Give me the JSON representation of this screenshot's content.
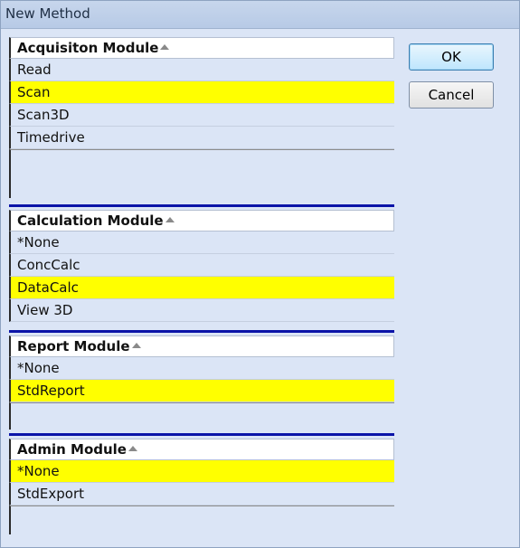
{
  "window": {
    "title": "New Method"
  },
  "buttons": {
    "ok_label": "OK",
    "cancel_label": "Cancel"
  },
  "acquisition": {
    "header": "Acquisiton Module",
    "items": [
      "Read",
      "Scan",
      "Scan3D",
      "Timedrive"
    ],
    "selected": "Scan"
  },
  "calculation": {
    "header": "Calculation Module",
    "items": [
      "*None",
      "ConcCalc",
      "DataCalc",
      "View 3D"
    ],
    "selected": "DataCalc"
  },
  "report": {
    "header": "Report Module",
    "items": [
      "*None",
      "StdReport"
    ],
    "selected": "StdReport"
  },
  "admin": {
    "header": "Admin Module",
    "items": [
      "*None",
      "StdExport"
    ],
    "selected": "*None"
  },
  "colors": {
    "selection": "#ffff00",
    "divider": "#0b14a8",
    "background": "#dbe5f6"
  }
}
